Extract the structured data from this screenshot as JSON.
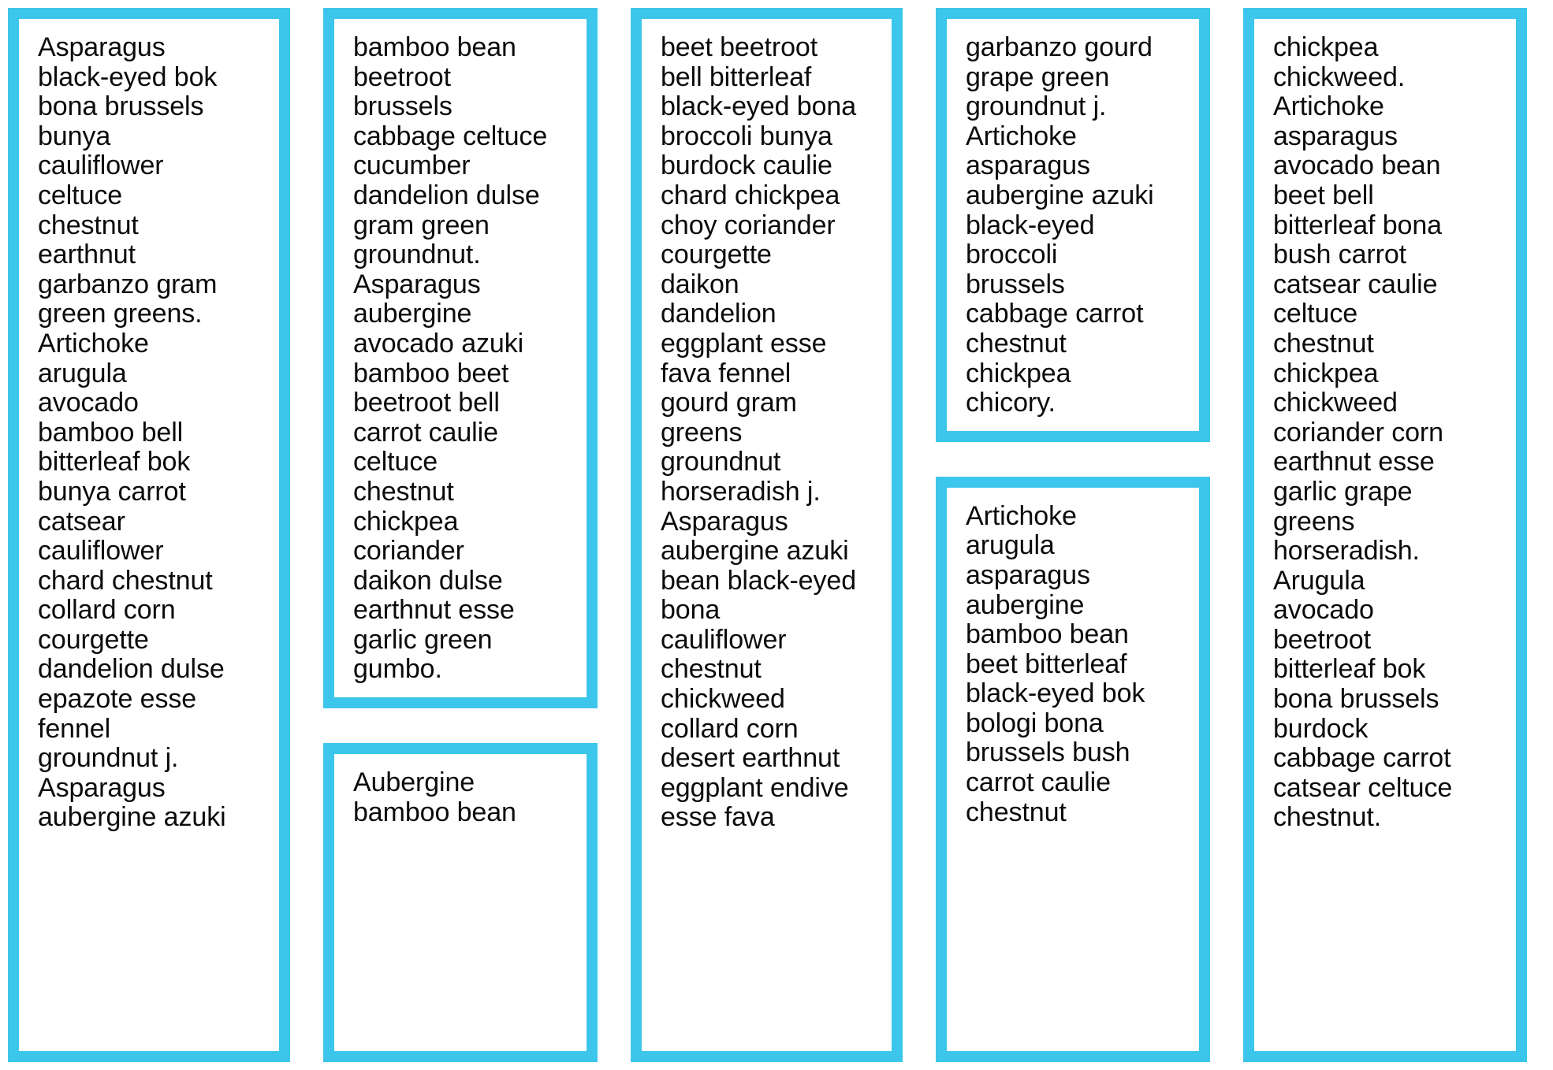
{
  "style": {
    "accent_color": "#3dc6ec",
    "text_color": "#0b0b0b",
    "background_color": "#ffffff"
  },
  "columns": [
    {
      "name": "column-1",
      "boxes": [
        {
          "name": "word-box-1",
          "lines": [
            "Asparagus",
            "black-eyed bok",
            "bona brussels",
            "bunya",
            "cauliflower",
            "celtuce",
            "chestnut",
            "earthnut",
            "garbanzo gram",
            "green greens.",
            "Artichoke",
            "arugula",
            "avocado",
            "bamboo bell",
            "bitterleaf bok",
            "bunya carrot",
            "catsear",
            "cauliflower",
            "chard chestnut",
            "collard corn",
            "courgette",
            "dandelion dulse",
            "epazote esse",
            "fennel",
            "groundnut j.",
            "Asparagus",
            "aubergine azuki"
          ]
        }
      ]
    },
    {
      "name": "column-2",
      "boxes": [
        {
          "name": "word-box-2",
          "lines": [
            "bamboo bean",
            "beetroot",
            "brussels",
            "cabbage celtuce",
            "cucumber",
            "dandelion dulse",
            "gram green",
            "groundnut.",
            "Asparagus",
            "aubergine",
            "avocado azuki",
            "bamboo beet",
            "beetroot bell",
            "carrot caulie",
            "celtuce",
            "chestnut",
            "chickpea",
            "coriander",
            "daikon dulse",
            "earthnut esse",
            "garlic green",
            "gumbo."
          ]
        },
        {
          "name": "word-box-3",
          "lines": [
            "Aubergine",
            "bamboo bean"
          ]
        }
      ]
    },
    {
      "name": "column-3",
      "boxes": [
        {
          "name": "word-box-4",
          "lines": [
            "beet beetroot",
            "bell bitterleaf",
            "black-eyed bona",
            "broccoli bunya",
            "burdock caulie",
            "chard chickpea",
            "choy coriander",
            "courgette",
            "daikon",
            "dandelion",
            "eggplant esse",
            "fava fennel",
            "gourd gram",
            "greens",
            "groundnut",
            "horseradish j.",
            "Asparagus",
            "aubergine azuki",
            "bean black-eyed",
            "bona",
            "cauliflower",
            "chestnut",
            "chickweed",
            "collard corn",
            "desert earthnut",
            "eggplant endive",
            "esse fava"
          ]
        }
      ]
    },
    {
      "name": "column-4",
      "boxes": [
        {
          "name": "word-box-5",
          "lines": [
            "garbanzo gourd",
            "grape green",
            "groundnut j.",
            "Artichoke",
            "asparagus",
            "aubergine azuki",
            "black-eyed",
            "broccoli",
            "brussels",
            "cabbage carrot",
            "chestnut",
            "chickpea",
            "chicory."
          ]
        },
        {
          "name": "word-box-6",
          "lines": [
            "Artichoke",
            "arugula",
            "asparagus",
            "aubergine",
            "bamboo bean",
            "beet bitterleaf",
            "black-eyed bok",
            "bologi bona",
            "brussels bush",
            "carrot caulie",
            "chestnut"
          ]
        }
      ]
    },
    {
      "name": "column-5",
      "boxes": [
        {
          "name": "word-box-7",
          "lines": [
            "chickpea",
            "chickweed.",
            "Artichoke",
            "asparagus",
            "avocado bean",
            "beet bell",
            "bitterleaf bona",
            "bush carrot",
            "catsear caulie",
            "celtuce",
            "chestnut",
            "chickpea",
            "chickweed",
            "coriander corn",
            "earthnut esse",
            "garlic grape",
            "greens",
            "horseradish.",
            "Arugula",
            "avocado",
            "beetroot",
            "bitterleaf bok",
            "bona brussels",
            "burdock",
            "cabbage carrot",
            "catsear celtuce",
            "chestnut."
          ]
        }
      ]
    }
  ]
}
